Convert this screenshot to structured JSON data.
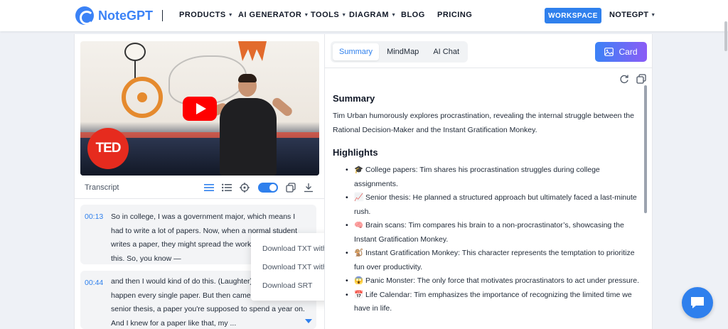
{
  "header": {
    "logo_text": "NoteGPT",
    "nav": [
      {
        "label": "PRODUCTS",
        "has_caret": true
      },
      {
        "label": "AI GENERATOR",
        "has_caret": true
      },
      {
        "label": "TOOLS",
        "has_caret": true
      },
      {
        "label": "DIAGRAM",
        "has_caret": true
      },
      {
        "label": "BLOG",
        "has_caret": false
      },
      {
        "label": "PRICING",
        "has_caret": false
      }
    ],
    "workspace_label": "WORKSPACE",
    "user_label": "NOTEGPT",
    "accent_color": "#2f80ed"
  },
  "video": {
    "badge_text": "TED",
    "play_icon": "youtube-play-icon"
  },
  "transcript": {
    "label": "Transcript",
    "toolbar_icons": [
      "list-timestamp-icon",
      "list-icon",
      "target-icon",
      "toggle-switch",
      "copy-icon",
      "download-icon"
    ],
    "toggle_on": true,
    "segments": [
      {
        "time": "00:13",
        "text": "So in college, I was a government major, which means I had to write a lot of papers. Now, when a normal student writes a paper, they might spread the work out a little like this. So, you know —"
      },
      {
        "time": "00:44",
        "text": "and then I would kind of do this. (Laughter) And that would happen every single paper. But then came my 90-page senior thesis, a paper you're supposed to spend a year on. And I knew for a paper like that, my ..."
      }
    ],
    "download_menu": [
      "Download TXT with timestamp",
      "Download TXT without timestamp",
      "Download SRT"
    ]
  },
  "right": {
    "tabs": [
      "Summary",
      "MindMap",
      "AI Chat"
    ],
    "active_tab": "Summary",
    "card_label": "Card",
    "summary_heading": "Summary",
    "summary_text": "Tim Urban humorously explores procrastination, revealing the internal struggle between the Rational Decision-Maker and the Instant Gratification Monkey.",
    "highlights_heading": "Highlights",
    "highlights": [
      {
        "emoji": "🎓",
        "text": "College papers: Tim shares his procrastination struggles during college assignments."
      },
      {
        "emoji": "📈",
        "text": "Senior thesis: He planned a structured approach but ultimately faced a last-minute rush."
      },
      {
        "emoji": "🧠",
        "text": "Brain scans: Tim compares his brain to a non-procrastinator’s, showcasing the Instant Gratification Monkey."
      },
      {
        "emoji": "🐒",
        "text": "Instant Gratification Monkey: This character represents the temptation to prioritize fun over productivity."
      },
      {
        "emoji": "😱",
        "text": "Panic Monster: The only force that motivates procrastinators to act under pressure."
      },
      {
        "emoji": "📅",
        "text": "Life Calendar: Tim emphasizes the importance of recognizing the limited time we have in life."
      }
    ]
  }
}
